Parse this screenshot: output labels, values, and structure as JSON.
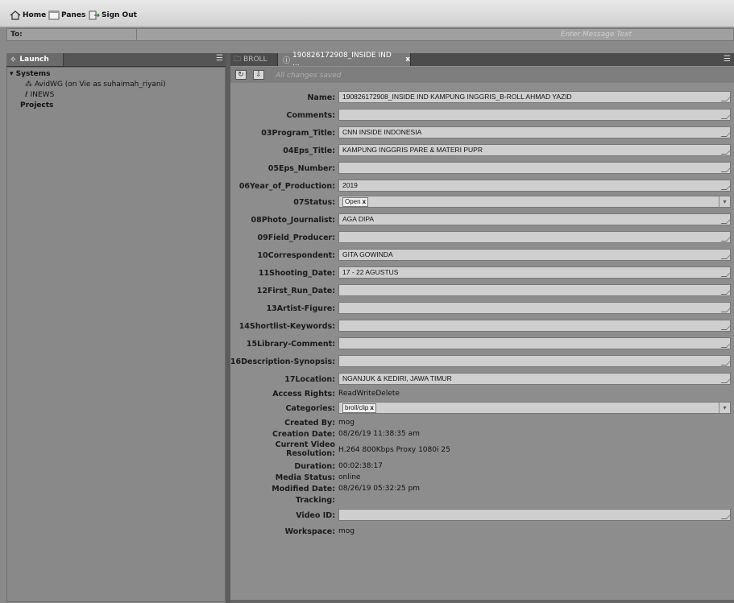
{
  "topbar": {
    "home": "Home",
    "panes": "Panes",
    "sign_out": "Sign Out"
  },
  "message_bar": {
    "to_label": "To:",
    "placeholder": "Enter Message Text"
  },
  "launch_panel": {
    "tab_label": "Launch",
    "tree": {
      "systems_label": "Systems",
      "avidwg": "AvidWG (on Vie as suhaimah_riyani)",
      "inews": "INEWS",
      "projects_label": "Projects"
    }
  },
  "detail_panel": {
    "tabs": {
      "broll": "BROLL",
      "asset": "190826172908_INSIDE IND ...",
      "close": "x"
    },
    "toolbar": {
      "status": "All changes saved"
    },
    "fields": {
      "name": {
        "label": "Name:",
        "value": "190826172908_INSIDE IND KAMPUNG INGGRIS_B-ROLL AHMAD YAZID"
      },
      "comments": {
        "label": "Comments:",
        "value": ""
      },
      "program_title": {
        "label": "03Program_Title:",
        "value": "CNN INSIDE INDONESIA"
      },
      "eps_title": {
        "label": "04Eps_Title:",
        "value": "KAMPUNG INGGRIS PARE & MATERI PUPR"
      },
      "eps_number": {
        "label": "05Eps_Number:",
        "value": ""
      },
      "year": {
        "label": "06Year_of_Production:",
        "value": "2019"
      },
      "status": {
        "label": "07Status:",
        "value": "Open"
      },
      "photo_journalist": {
        "label": "08Photo_Journalist:",
        "value": "AGA DIPA"
      },
      "field_producer": {
        "label": "09Field_Producer:",
        "value": ""
      },
      "correspondent": {
        "label": "10Correspondent:",
        "value": "GITA GOWINDA"
      },
      "shooting_date": {
        "label": "11Shooting_Date:",
        "value": "17 - 22 AGUSTUS"
      },
      "first_run_date": {
        "label": "12First_Run_Date:",
        "value": ""
      },
      "artist_figure": {
        "label": "13Artist-Figure:",
        "value": ""
      },
      "shortlist_keywords": {
        "label": "14Shortlist-Keywords:",
        "value": ""
      },
      "library_comment": {
        "label": "15Library-Comment:",
        "value": ""
      },
      "description": {
        "label": "16Description-Synopsis:",
        "value": ""
      },
      "location": {
        "label": "17Location:",
        "value": "NGANJUK & KEDIRI, JAWA TIMUR"
      },
      "access_rights": {
        "label": "Access Rights:",
        "value": "ReadWriteDelete"
      },
      "categories": {
        "label": "Categories:",
        "value": "broll/clip"
      },
      "created_by": {
        "label": "Created By:",
        "value": "mog"
      },
      "creation_date": {
        "label": "Creation Date:",
        "value": "08/26/19 11:38:35 am"
      },
      "current_video_res": {
        "label_line1": "Current Video",
        "label_line2": "Resolution:",
        "value": "H.264 800Kbps Proxy 1080i 25"
      },
      "duration": {
        "label": "Duration:",
        "value": "00:02:38:17"
      },
      "media_status": {
        "label": "Media Status:",
        "value": "online"
      },
      "modified_date": {
        "label": "Modified Date:",
        "value": "08/26/19 05:32:25 pm"
      },
      "tracking": {
        "label": "Tracking:",
        "value": ""
      },
      "video_id": {
        "label": "Video ID:",
        "value": ""
      },
      "workspace": {
        "label": "Workspace:",
        "value": "mog"
      }
    }
  }
}
